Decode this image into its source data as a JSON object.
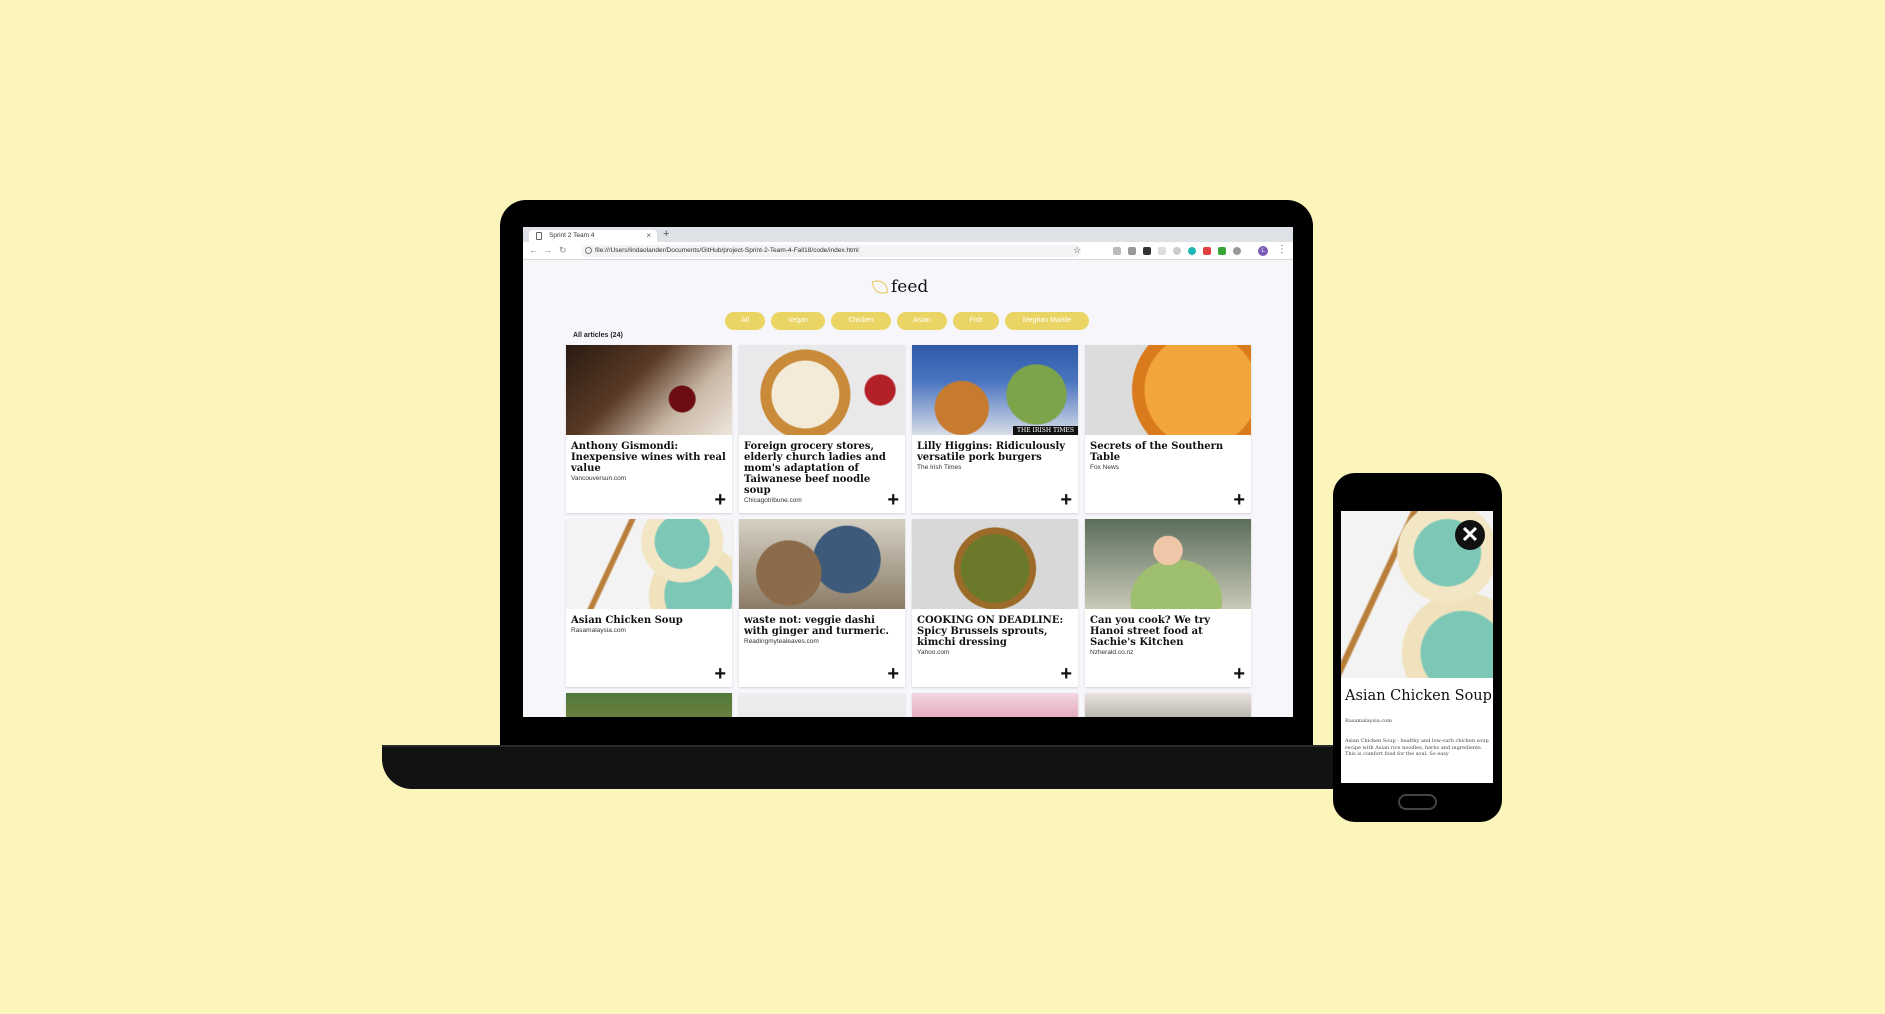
{
  "browser": {
    "tab_title": "Sprint 2 Team 4",
    "tab_close": "×",
    "new_tab": "+",
    "url": "file:///Users/lindaolander/Documents/GitHub/project-Sprint-2-Team-4-Fall18/code/index.html",
    "back": "←",
    "forward": "→",
    "reload": "↻",
    "bookmark_star": "☆",
    "profile_initial": "L",
    "menu": "⋮"
  },
  "site": {
    "logo_text": "feed",
    "filters": [
      "All",
      "Vegan",
      "Chicken",
      "Asian",
      "Fish",
      "Meghan Markle"
    ],
    "articles_count_label": "All articles (24)",
    "add_label": "+",
    "articles": [
      {
        "title": "Anthony Gismondi: Inexpensive wines with real value",
        "source": "Vancouversun.com",
        "image": "wine-glass"
      },
      {
        "title": "Foreign grocery stores, elderly church ladies and mom's adaptation of Taiwanese beef noodle soup",
        "source": "Chicagotribune.com",
        "image": "beef-noodle-soup"
      },
      {
        "title": "Lilly Higgins: Ridiculously versatile pork burgers",
        "source": "The Irish Times",
        "image": "pork-burger",
        "image_caption": "THE IRISH TIMES"
      },
      {
        "title": "Secrets of the Southern Table",
        "source": "Fox News",
        "image": "peach-tart"
      },
      {
        "title": "Asian Chicken Soup",
        "source": "Rasamalaysia.com",
        "image": "chicken-soup-bowls"
      },
      {
        "title": "waste not: veggie dashi with ginger and turmeric.",
        "source": "Readingmytealeaves.com",
        "image": "mushrooms-cloth"
      },
      {
        "title": "COOKING ON DEADLINE: Spicy Brussels sprouts, kimchi dressing",
        "source": "Yahoo.com",
        "image": "brussels-sprouts"
      },
      {
        "title": "Can you cook? We try Hanoi street food at Sachie's Kitchen",
        "source": "Nzherald.co.nz",
        "image": "woman-cooking"
      }
    ]
  },
  "phone": {
    "close": "✕",
    "title": "Asian Chicken Soup",
    "source": "Rasamalaysia.com",
    "description": "Asian Chicken Soup - healthy and low-carb chicken soup recipe with Asian rice noodles, herbs and ingredients. This is comfort food for the soul. So easy"
  },
  "colors": {
    "background": "#fbf5bc",
    "chip": "#ead564",
    "page": "#f7f7fb"
  }
}
